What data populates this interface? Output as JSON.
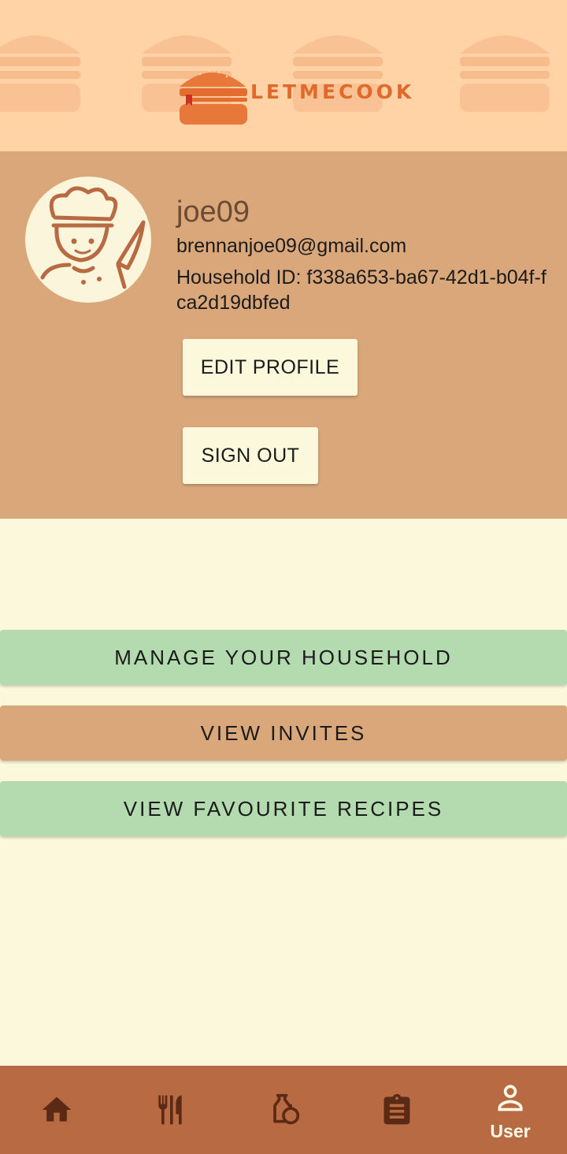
{
  "app": {
    "logo_text": "LETMECOOK"
  },
  "profile": {
    "username": "joe09",
    "email": "brennanjoe09@gmail.com",
    "household_id": "Household ID: f338a653-ba67-42d1-b04f-fca2d19dbfed",
    "edit_label": "EDIT PROFILE",
    "signout_label": "SIGN OUT"
  },
  "actions": {
    "manage_household": "MANAGE YOUR HOUSEHOLD",
    "view_invites": "VIEW INVITES",
    "view_favourites": "VIEW FAVOURITE RECIPES"
  },
  "nav": {
    "items": [
      {
        "icon": "home-icon"
      },
      {
        "icon": "utensils-icon"
      },
      {
        "icon": "pantry-icon"
      },
      {
        "icon": "clipboard-icon"
      },
      {
        "icon": "user-icon",
        "label": "User"
      }
    ],
    "active_index": 4
  },
  "colors": {
    "header": "#ffd3a6",
    "profile_band": "#d9a77a",
    "page_bg": "#fbf8dc",
    "green_button": "#b3dbaf",
    "tan_button": "#d9a77a",
    "nav_bar": "#b86b42",
    "nav_icon": "#5b2a14"
  }
}
